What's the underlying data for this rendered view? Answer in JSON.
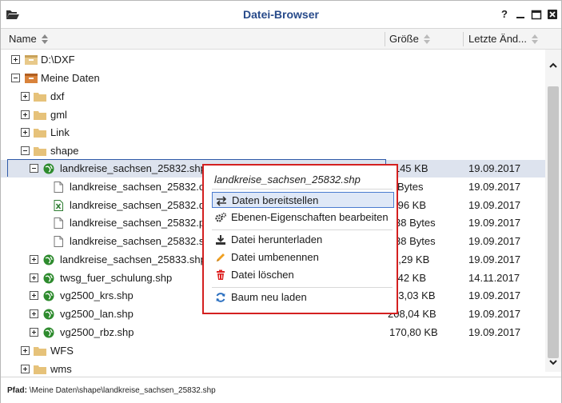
{
  "window": {
    "title": "Datei-Browser",
    "buttons": {
      "help": "?",
      "minimize": "—",
      "maximize": "□",
      "close": "✕"
    }
  },
  "header": {
    "name": "Name",
    "size": "Größe",
    "modified": "Letzte Änd..."
  },
  "tree": [
    {
      "name": "D:\\DXF",
      "size": "",
      "date": ""
    },
    {
      "name": "Meine Daten",
      "size": "",
      "date": ""
    },
    {
      "name": "dxf",
      "size": "",
      "date": ""
    },
    {
      "name": "gml",
      "size": "",
      "date": ""
    },
    {
      "name": "Link",
      "size": "",
      "date": ""
    },
    {
      "name": "shape",
      "size": "",
      "date": ""
    },
    {
      "name": "landkreise_sachsen_25832.shp",
      "size": "1.145 KB",
      "date": "19.09.2017"
    },
    {
      "name": "landkreise_sachsen_25832.cpg",
      "size": "Bytes",
      "date": "19.09.2017"
    },
    {
      "name": "landkreise_sachsen_25832.dbf",
      "size": ",96 KB",
      "date": "19.09.2017"
    },
    {
      "name": "landkreise_sachsen_25832.prj",
      "size": "38 Bytes",
      "date": "19.09.2017"
    },
    {
      "name": "landkreise_sachsen_25832.shx",
      "size": "38 Bytes",
      "date": "19.09.2017"
    },
    {
      "name": "landkreise_sachsen_25833.shp",
      "size": "6,29 KB",
      "date": "19.09.2017"
    },
    {
      "name": "twsg_fuer_schulung.shp",
      "size": ",42 KB",
      "date": "14.11.2017"
    },
    {
      "name": "vg2500_krs.shp",
      "size": "73,03 KB",
      "date": "19.09.2017"
    },
    {
      "name": "vg2500_lan.shp",
      "size": "208,04 KB",
      "date": "19.09.2017"
    },
    {
      "name": "vg2500_rbz.shp",
      "size": "170,80 KB",
      "date": "19.09.2017"
    },
    {
      "name": "WFS",
      "size": "",
      "date": ""
    },
    {
      "name": "wms",
      "size": "",
      "date": ""
    }
  ],
  "context_menu": {
    "header": "landkreise_sachsen_25832.shp",
    "items": [
      {
        "label": "Daten bereitstellen"
      },
      {
        "label": "Ebenen-Eigenschaften bearbeiten"
      },
      {
        "label": "Datei herunterladen"
      },
      {
        "label": "Datei umbenennen"
      },
      {
        "label": "Datei löschen"
      },
      {
        "label": "Baum neu laden"
      }
    ]
  },
  "pathbar": {
    "label": "Pfad:",
    "value": "\\Meine Daten\\shape\\landkreise_sachsen_25832.shp"
  },
  "colors": {
    "title": "#274a8a",
    "selection": "#dde3ee",
    "menu_border": "#d42020",
    "folder": "#e6c27a",
    "shp_globe": "#2e8b2e"
  }
}
